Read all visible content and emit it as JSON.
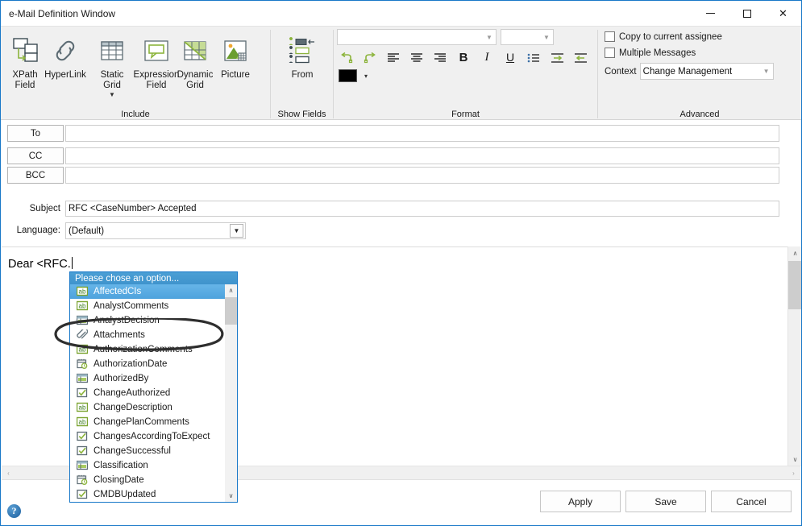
{
  "window": {
    "title": "e-Mail Definition Window",
    "minimize_label": "minimize",
    "maximize_label": "maximize",
    "close_label": "✕"
  },
  "ribbon": {
    "groups": [
      {
        "name": "include",
        "label": "Include"
      },
      {
        "name": "show_fields",
        "label": "Show Fields"
      },
      {
        "name": "format",
        "label": "Format"
      },
      {
        "name": "advanced",
        "label": "Advanced"
      }
    ],
    "include_buttons": [
      {
        "icon": "xpath-field-icon",
        "label": "XPath\nField",
        "line1": "XPath",
        "line2": "Field"
      },
      {
        "icon": "hyperlink-icon",
        "label": "HyperLink",
        "line1": "HyperLink",
        "line2": ""
      },
      {
        "icon": "static-grid-icon",
        "label": "Static Grid",
        "line1": "Static",
        "line2": "Grid",
        "has_caret": true
      },
      {
        "icon": "expression-field-icon",
        "label": "Expression Field",
        "line1": "Expression",
        "line2": "Field"
      },
      {
        "icon": "dynamic-grid-icon",
        "label": "Dynamic Grid",
        "line1": "Dynamic",
        "line2": "Grid"
      },
      {
        "icon": "picture-icon",
        "label": "Picture",
        "line1": "Picture",
        "line2": ""
      }
    ],
    "show_fields": {
      "from_label": "From",
      "from_icon": "from-fields-icon"
    },
    "format": {
      "font_name_value": "",
      "font_size_value": "",
      "buttons": [
        {
          "name": "undo-button",
          "icon": "undo-icon"
        },
        {
          "name": "redo-button",
          "icon": "redo-icon"
        },
        {
          "name": "align-left-button",
          "icon": "align-left-icon"
        },
        {
          "name": "align-center-button",
          "icon": "align-center-icon"
        },
        {
          "name": "align-right-button",
          "icon": "align-right-icon"
        },
        {
          "name": "bold-button",
          "icon": "bold-icon",
          "glyph": "B"
        },
        {
          "name": "italic-button",
          "icon": "italic-icon",
          "glyph": "I"
        },
        {
          "name": "underline-button",
          "icon": "underline-icon",
          "glyph": "U"
        },
        {
          "name": "bullet-list-button",
          "icon": "bullet-list-icon"
        },
        {
          "name": "indent-increase-button",
          "icon": "indent-increase-icon"
        },
        {
          "name": "indent-decrease-button",
          "icon": "indent-decrease-icon"
        }
      ],
      "font_color_value": "#000000",
      "font_color_caret": "▾"
    },
    "advanced": {
      "copy_assignee_label": "Copy to current assignee",
      "copy_assignee_checked": false,
      "multiple_messages_label": "Multiple Messages",
      "multiple_messages_checked": false,
      "context_label": "Context",
      "context_value": "Change Management"
    }
  },
  "recipients": [
    {
      "name": "to",
      "button_label": "To",
      "value": ""
    },
    {
      "name": "cc",
      "button_label": "CC",
      "value": ""
    },
    {
      "name": "bcc",
      "button_label": "BCC",
      "value": ""
    }
  ],
  "subject": {
    "label": "Subject",
    "value": "RFC <CaseNumber> Accepted"
  },
  "language": {
    "label": "Language:",
    "value": "(Default)",
    "arrow": "▼"
  },
  "body": {
    "text": "Dear <RFC."
  },
  "dropdown": {
    "header": "Please chose an option...",
    "selected_index": 0,
    "items": [
      {
        "label": "AffectedCIs",
        "icon": "text-field-icon"
      },
      {
        "label": "AnalystComments",
        "icon": "text-field-icon"
      },
      {
        "label": "AnalystDecision",
        "icon": "lookup-field-icon"
      },
      {
        "label": "Attachments",
        "icon": "paperclip-icon"
      },
      {
        "label": "AuthorizationComments",
        "icon": "text-field-icon"
      },
      {
        "label": "AuthorizationDate",
        "icon": "date-field-icon"
      },
      {
        "label": "AuthorizedBy",
        "icon": "lookup-field-icon"
      },
      {
        "label": "ChangeAuthorized",
        "icon": "checkbox-field-icon"
      },
      {
        "label": "ChangeDescription",
        "icon": "text-field-icon"
      },
      {
        "label": "ChangePlanComments",
        "icon": "text-field-icon"
      },
      {
        "label": "ChangesAccordingToExpect",
        "icon": "checkbox-field-icon"
      },
      {
        "label": "ChangeSuccessful",
        "icon": "checkbox-field-icon"
      },
      {
        "label": "Classification",
        "icon": "lookup-field-icon"
      },
      {
        "label": "ClosingDate",
        "icon": "date-field-icon"
      },
      {
        "label": "CMDBUpdated",
        "icon": "checkbox-field-icon"
      }
    ],
    "scroll_up_arrow": "∧",
    "scroll_down_arrow": "∨"
  },
  "footer": {
    "apply_label": "Apply",
    "save_label": "Save",
    "cancel_label": "Cancel",
    "help_label": "?"
  },
  "scrollbars": {
    "vertical_up": "∧",
    "vertical_down": "∨",
    "horizontal_left": "‹",
    "horizontal_right": "›"
  },
  "colors": {
    "accent": "#1878c8",
    "ribbon_bg": "#f0f0f0",
    "icon_green": "#8cb43c",
    "icon_dark": "#3b4a52",
    "selection": "#4ea3dd"
  }
}
